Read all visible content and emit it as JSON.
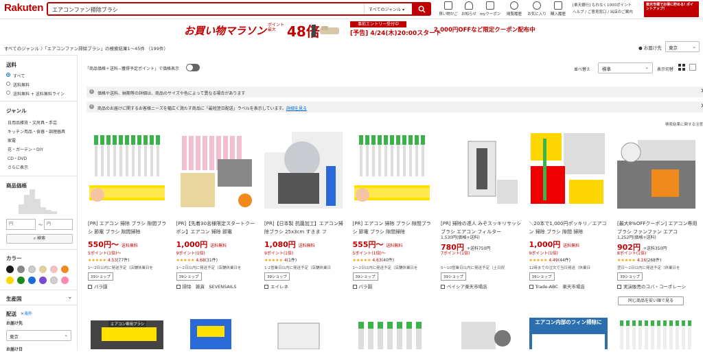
{
  "header": {
    "logo": "Rakuten",
    "search_value": "エアコンファン掃除ブラシ",
    "genre": "すべてのジャンル",
    "icons": [
      {
        "label": "買い物かご",
        "icon": "cart-icon"
      },
      {
        "label": "お知らせ",
        "icon": "bell-icon"
      },
      {
        "label": "myクーポン",
        "icon": "coupon-icon"
      },
      {
        "label": "閲覧履歴",
        "icon": "history-icon"
      },
      {
        "label": "お気に入り",
        "icon": "heart-icon"
      },
      {
        "label": "購入履歴",
        "icon": "receipt-icon"
      }
    ],
    "bank_text": "[楽天銀行] もれなく1000ポイント",
    "help_text": "ヘルプ / ご意見窓口 / 出店のご案内",
    "banner_text": "楽天市場でお得に貯める! ポイントアップ!"
  },
  "promo": {
    "title": "お買い物マラソン",
    "point_label": "ポイント 最大",
    "point_value": "48倍",
    "entry_label": "事前エントリー受付中",
    "date": "[予告] 4/24(木)20:00スタート",
    "coupon": "2,000円OFFなど限定クーポン配布中"
  },
  "breadcrumb": "すべてのジャンル 〉「エアコンファン掃除ブラシ」の検索結果1〜45件 （199件）",
  "deliver_label": "お届け先",
  "deliver_value": "東京",
  "sidebar": {
    "shipping_title": "送料",
    "shipping_options": [
      "すべて",
      "送料無料",
      "送料無料 + 送料無料ライン"
    ],
    "genre_title": "ジャンル",
    "genres": [
      "日用品雑貨・文房具・手芸",
      "キッチン用品・食器・調理器具",
      "家電",
      "花・ガーデン・DIY",
      "CD・DVD",
      "さらに表示"
    ],
    "price_title": "商品価格",
    "price_min_placeholder": "円",
    "price_max_placeholder": "円",
    "price_search": "検索",
    "color_title": "カラー",
    "colors": [
      "#1a1a1a",
      "#888888",
      "#cccccc",
      "#e0cfa0",
      "#f2c0c0",
      "#f08a1c",
      "#ffd700",
      "#1a8a1a",
      "#1a6ad8",
      "#7a4ad0",
      "#d0d0d0",
      "#ff8ab0"
    ],
    "origin_title": "生産国",
    "delivery_title": "配送",
    "overseas": "✕海外",
    "deliver_to": "お届け先",
    "deliver_to_value": "東京",
    "deliver_date": "お届け日"
  },
  "toolbar": {
    "price_toggle": "「商品価格＋送料−獲得予定ポイント」で価格表示",
    "sort_label": "並べ替え",
    "sort_value": "標準",
    "view_label": "表示切替"
  },
  "info": {
    "notice1": "価格や送料、納期等の詳細は、商品のサイズや色によって異なる場合があります",
    "notice2": "商品のお届けに関するお客様ニーズを幅広く満たす商品に「最短翌日配送」ラベルを表示しています。",
    "notice2_link": "詳細を見る",
    "search_note": "検索結果に関する注意"
  },
  "products": [
    {
      "title": "[PR] エアコン 掃除 ブラシ 隙間ブラシ 節電 ブラシ 隙間掃除",
      "price": "550円〜",
      "ship": "送料無料",
      "points": "5ポイント(1倍)〜",
      "rating": "4.53",
      "reviews": "(77件)",
      "ship_date": "1〜2日以内に発送予定（店舗休業日を",
      "badge": "39ショップ",
      "shop": "パラ園"
    },
    {
      "title": "[PR]【先着30名様限定スタートクーポン】エアコン 掃除 節電",
      "price": "1,000円",
      "ship": "送料無料",
      "points": "9ポイント(1倍)",
      "rating": "4.68",
      "reviews": "(31件)",
      "ship_date": "1〜2日以内に発送予定（店舗休業日を",
      "badge": "39ショップ",
      "shop": "掃除　雑貨　SEVENSAILS"
    },
    {
      "title": "[PR]【日本製 抗菌加工】エアコン掃除ブラシ 25x3cm すきま フ",
      "price": "1,080円",
      "ship": "送料無料",
      "points": "9ポイント(1倍)",
      "rating": "4",
      "reviews": "(1件)",
      "ship_date": "1-2営業日以内に発送予定（店舗休業日",
      "badge": "39ショップ",
      "shop": "エイレネ"
    },
    {
      "title": "[PR] エアコン 掃除 ブラシ 隙間ブラシ 節電 ブラシ 隙間掃除",
      "price": "555円〜",
      "ship": "送料無料",
      "points": "5ポイント(1倍)〜",
      "rating": "4.63",
      "reviews": "(40件)",
      "ship_date": "1〜2日以内に発送予定（店舗休業日を",
      "badge": "39ショップ",
      "shop": "パラ園"
    },
    {
      "title": "[PR] 掃除の達人 みぞスッキリサッシブラシ エアコン フィルター",
      "sub": "1,530円(価格+送料)",
      "price": "780円",
      "ship": "+送料750円",
      "points": "7ポイント(1倍)",
      "rating": "",
      "reviews": "",
      "ship_date": "5〜10営業日以内に発送予定（土日祝",
      "badge": "39ショップ",
      "shop": "ベイシア楽天市場店"
    },
    {
      "title": "＼20本で1,000円ポッキリ／エアコン 掃除 ブラシ 隙間 掃除",
      "price": "1,000円",
      "ship": "送料無料",
      "points": "9ポイント(1倍)",
      "rating": "4.49",
      "reviews": "(44件)",
      "ship_date": "12時までの注文で当日発送（休業日",
      "badge": "39ショップ",
      "shop": "Trade-ABC　楽天市場店"
    },
    {
      "title": "[最大8%OFFクーポン] エアコン専用ブラシ ファンファン エアコ",
      "sub": "1,252円(価格+送料)",
      "price": "902円",
      "ship": "+送料350円",
      "points": "8ポイント(1倍)",
      "rating": "4.16",
      "reviews": "(268件)",
      "ship_date": "翌日〜2日以内に発送予定（休業日を",
      "badge": "39ショップ",
      "shop": "実演販売のコバ・コーポレーシ"
    }
  ],
  "same_shop": "同じ商品を安い順で見る",
  "row2_labels": [
    "エアコン専用ブラシ",
    "エアコン内部のフィン掃除に"
  ]
}
